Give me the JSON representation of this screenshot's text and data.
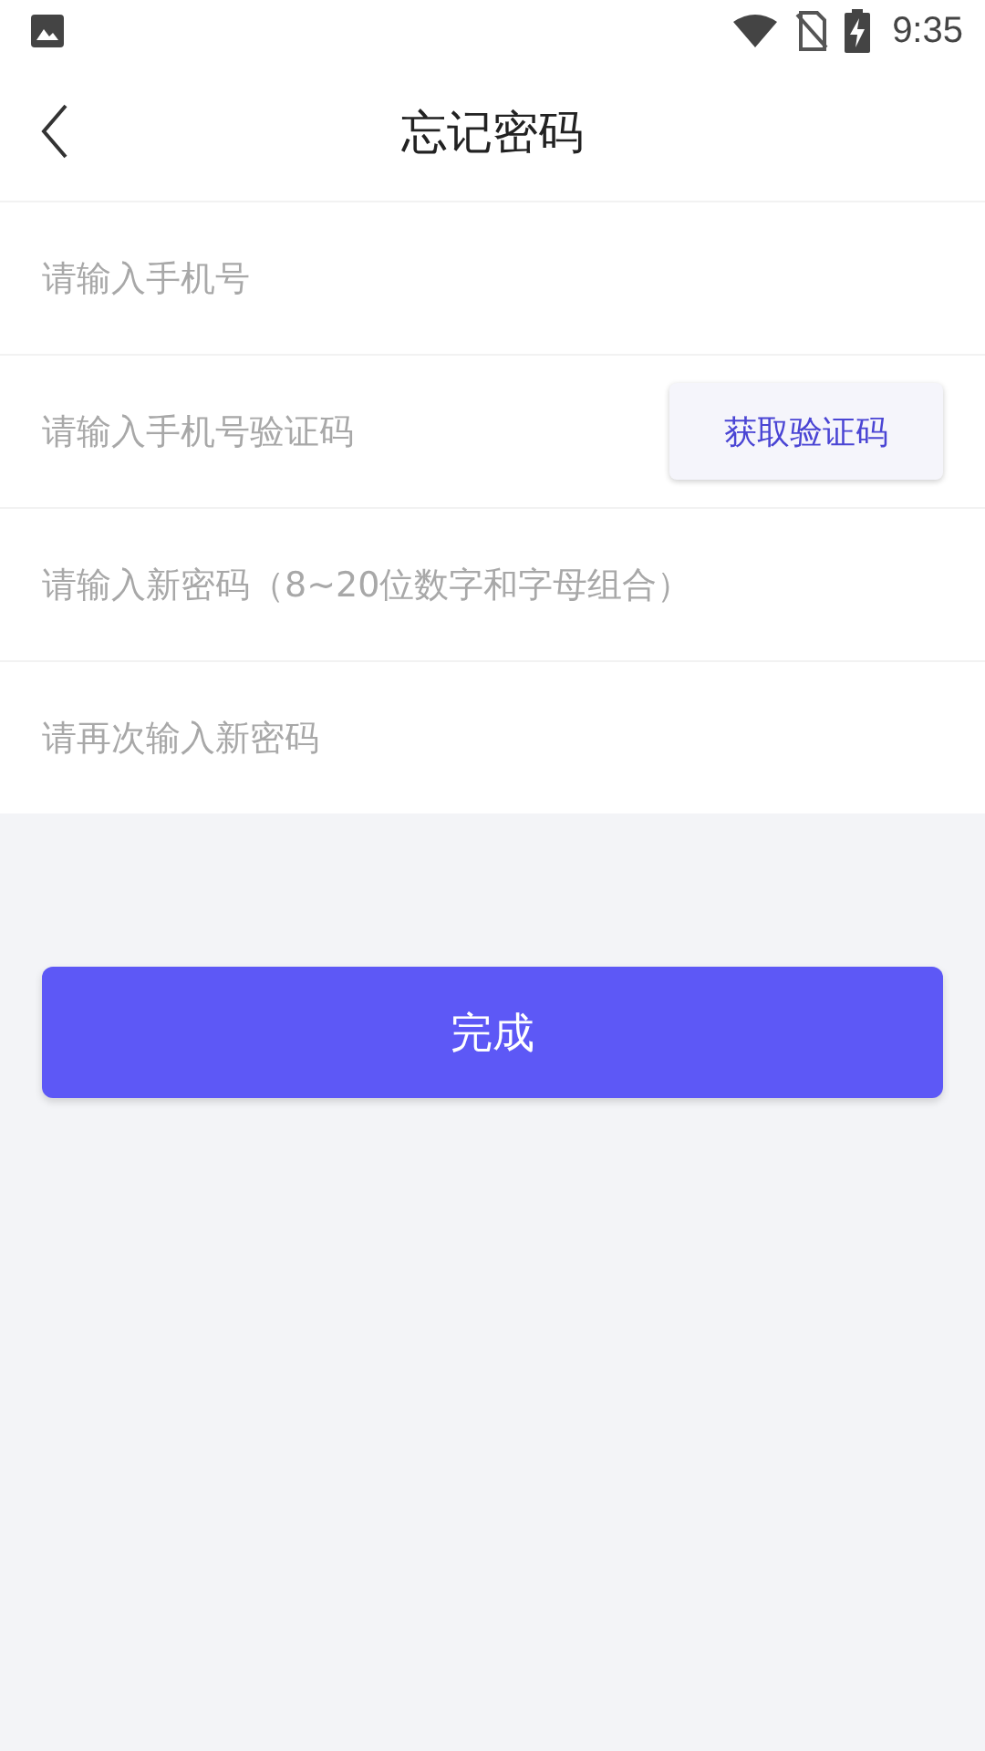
{
  "status_bar": {
    "time": "9:35"
  },
  "header": {
    "title": "忘记密码"
  },
  "fields": [
    {
      "kind": "text",
      "placeholder": "请输入手机号"
    },
    {
      "kind": "code",
      "placeholder": "请输入手机号验证码",
      "button": "获取验证码"
    },
    {
      "kind": "password",
      "placeholder": "请输入新密码（8~20位数字和字母组合）"
    },
    {
      "kind": "password",
      "placeholder": "请再次输入新密码"
    }
  ],
  "submit": "完成"
}
